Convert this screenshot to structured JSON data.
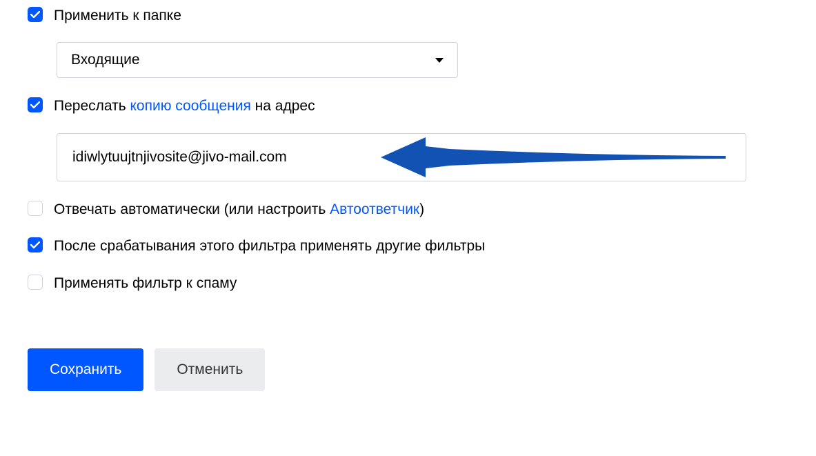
{
  "apply_to_folder": {
    "checked": true,
    "label": "Применить к папке",
    "selected_value": "Входящие"
  },
  "forward_copy": {
    "checked": true,
    "label_before": "Переслать ",
    "link_text": "копию сообщения",
    "label_after": " на адрес",
    "email_value": "idiwlytuujtnjivosite@jivo-mail.com"
  },
  "auto_reply": {
    "checked": false,
    "label_before": "Отвечать автоматически (или настроить ",
    "link_text": "Автоответчик",
    "label_after": ")"
  },
  "continue_filters": {
    "checked": true,
    "label": "После срабатывания этого фильтра применять другие фильтры"
  },
  "apply_to_spam": {
    "checked": false,
    "label": "Применять фильтр к спаму"
  },
  "buttons": {
    "save": "Сохранить",
    "cancel": "Отменить"
  }
}
